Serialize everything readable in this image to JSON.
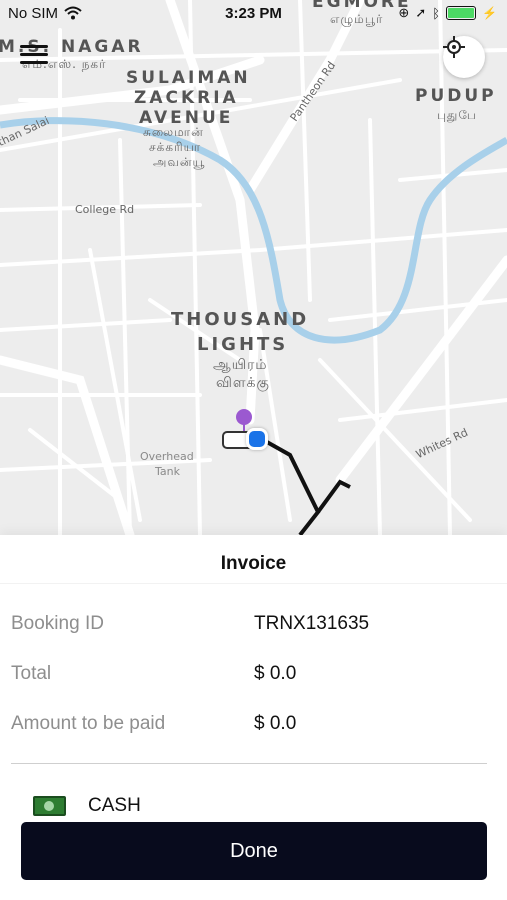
{
  "status_bar": {
    "carrier": "No SIM",
    "time": "3:23 PM",
    "icons": [
      "wifi-icon",
      "lock-rotation-icon",
      "location-arrow-icon",
      "bluetooth-icon",
      "battery-icon",
      "charging-icon"
    ]
  },
  "map": {
    "labels": {
      "ms_nagar": "M.S. NAGAR",
      "ms_nagar_ta": "எம்.எஸ். நகர்",
      "sulaiman_1": "SULAIMAN",
      "sulaiman_2": "ZACKRIA",
      "sulaiman_3": "AVENUE",
      "sulaiman_ta_1": "சுலைமான்",
      "sulaiman_ta_2": "சக்கரியா",
      "sulaiman_ta_3": "அவன்யூ",
      "egmore": "EGMORE",
      "egmore_ta": "எழும்பூர்",
      "pudup": "PUDUP",
      "pudup_ta": "புதுபே",
      "thousand_1": "THOUSAND",
      "thousand_2": "LIGHTS",
      "thousand_ta_1": "ஆயிரம்",
      "thousand_ta_2": "விளக்கு",
      "college_rd": "College Rd",
      "pantheon_rd": "Pantheon Rd",
      "whites_rd": "Whites Rd",
      "anna_salai": "than Salai",
      "overhead_tank_1": "Overhead",
      "overhead_tank_2": "Tank"
    },
    "colors": {
      "background": "#ededed",
      "road": "#ffffff",
      "river": "#a8d0ea",
      "route": "#111111",
      "pin": "#9b59d0",
      "user_dot": "#1a73e8"
    }
  },
  "invoice": {
    "title": "Invoice",
    "rows": [
      {
        "label": "Booking ID",
        "value": "TRNX131635"
      },
      {
        "label": "Total",
        "value": "$ 0.0"
      },
      {
        "label": "Amount to be paid",
        "value": "$ 0.0"
      }
    ],
    "payment_method": "CASH",
    "done_label": "Done",
    "colors": {
      "done_button": "#080b1d",
      "label": "#8e8e8e"
    }
  }
}
